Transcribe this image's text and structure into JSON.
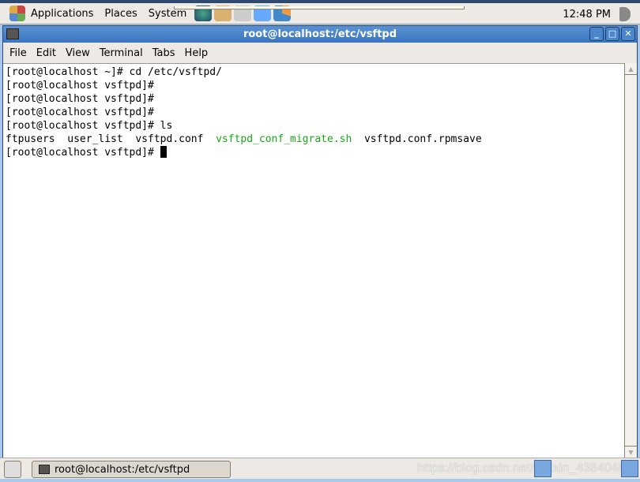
{
  "top_panel": {
    "menus": [
      "Applications",
      "Places",
      "System"
    ],
    "clock": "12:48 PM"
  },
  "window": {
    "title": "root@localhost:/etc/vsftpd",
    "menu": [
      "File",
      "Edit",
      "View",
      "Terminal",
      "Tabs",
      "Help"
    ]
  },
  "terminal": {
    "lines": [
      "[root@localhost ~]# cd /etc/vsftpd/",
      "[root@localhost vsftpd]#",
      "[root@localhost vsftpd]#",
      "[root@localhost vsftpd]#",
      "[root@localhost vsftpd]# ls"
    ],
    "ls_output": {
      "a": "ftpusers  user_list  vsftpd.conf  ",
      "b": "vsftpd_conf_migrate.sh",
      "c": "  vsftpd.conf.rpmsave"
    },
    "prompt": "[root@localhost vsftpd]# ",
    "exec_color": "#1aa81a"
  },
  "taskbar": {
    "task": "root@localhost:/etc/vsftpd",
    "watermark": "https://blog.csdn.net/weixin_43840483"
  }
}
